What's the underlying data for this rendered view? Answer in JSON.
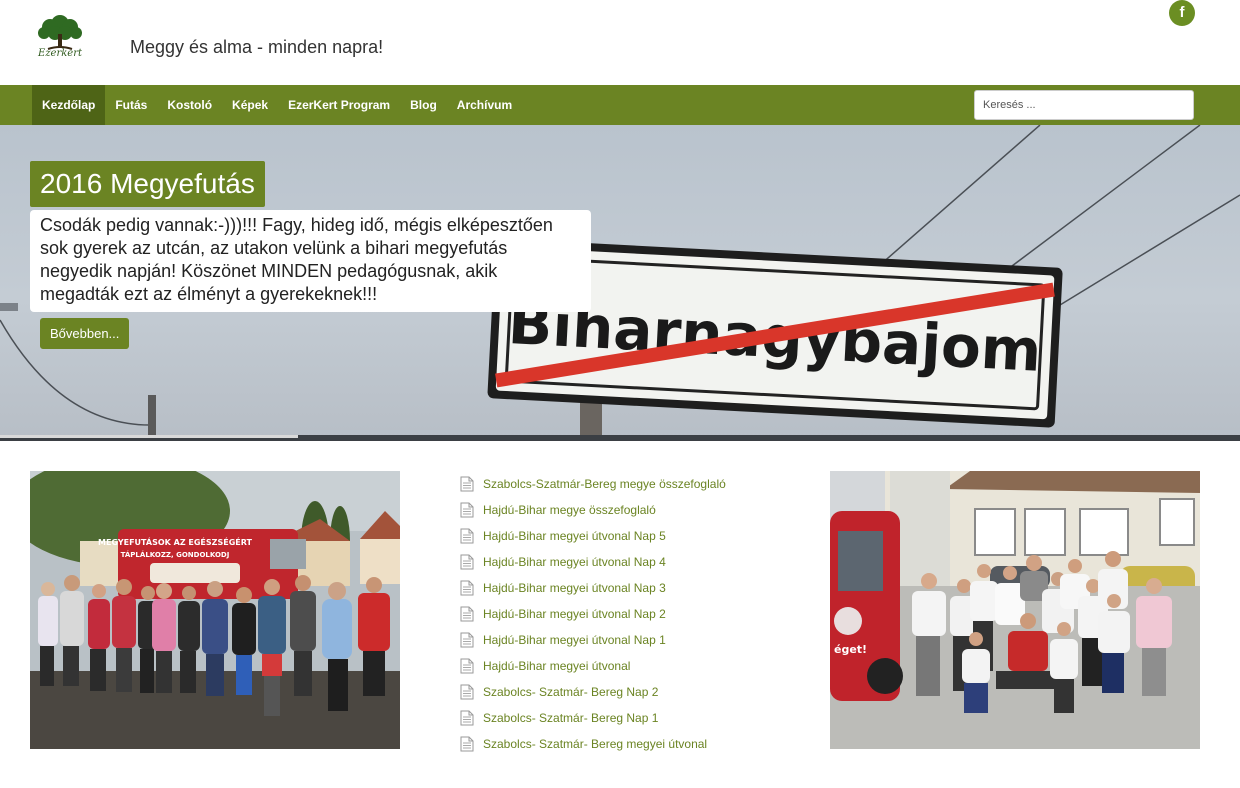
{
  "header": {
    "logo_text": "Ezerkert",
    "tagline": "Meggy és alma - minden napra!",
    "facebook_glyph": "f"
  },
  "nav": {
    "items": [
      {
        "label": "Kezdőlap",
        "active": true
      },
      {
        "label": "Futás",
        "active": false
      },
      {
        "label": "Kostoló",
        "active": false
      },
      {
        "label": "Képek",
        "active": false
      },
      {
        "label": "EzerKert Program",
        "active": false
      },
      {
        "label": "Blog",
        "active": false
      },
      {
        "label": "Archívum",
        "active": false
      }
    ],
    "search_placeholder": "Keresés ..."
  },
  "hero": {
    "title": "2016 Megyefutás",
    "text": "Csodák pedig vannak:-)))!!! Fagy, hideg idő, mégis elképesztően sok gyerek az utcán, az utakon velünk a bihari megyefutás negyedik napján! Köszönet MINDEN pedagógusnak, akik megadták ezt az élményt a gyerekeknek!!!",
    "button_label": "Bővebben...",
    "sign_text": "Biharnagybajom",
    "slide_progress": 0.24
  },
  "articles": [
    "Szabolcs-Szatmár-Bereg megye összefoglaló",
    "Hajdú-Bihar megye összefoglaló",
    "Hajdú-Bihar megyei útvonal Nap 5",
    "Hajdú-Bihar megyei útvonal Nap 4",
    "Hajdú-Bihar megyei útvonal Nap 3",
    "Hajdú-Bihar megyei útvonal Nap 2",
    "Hajdú-Bihar megyei útvonal Nap 1",
    "Hajdú-Bihar megyei útvonal",
    "Szabolcs- Szatmár- Bereg Nap 2",
    "Szabolcs- Szatmár- Bereg Nap 1",
    "Szabolcs- Szatmár- Bereg megyei útvonal"
  ],
  "photos": {
    "left_van_text_1": "MEGYEFUTÁSOK AZ EGÉSZSÉGÉRT",
    "left_van_text_2": "TÁPLÁLKOZZ, GONDOLKODJ",
    "right_van_text": "éget!"
  },
  "colors": {
    "brand_green": "#6b8423",
    "nav_active": "#4e6416",
    "link_green": "#6b8423"
  },
  "icons": {
    "facebook": "facebook-icon",
    "article": "document-icon",
    "logo": "tree-logo-icon"
  }
}
